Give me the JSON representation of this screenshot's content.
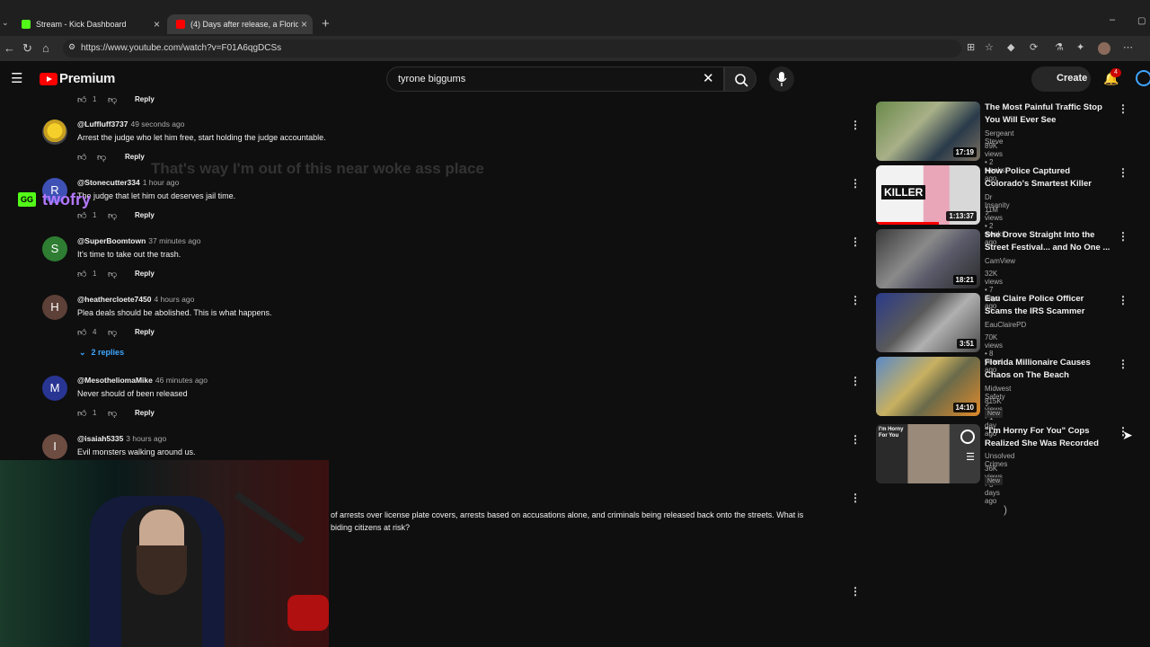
{
  "browser": {
    "tabs": [
      {
        "title": "Stream - Kick Dashboard",
        "favicon_color": "#53fc18"
      },
      {
        "title": "(4) Days after release, a Florida m",
        "favicon_color": "#ff0000"
      }
    ],
    "url": "https://www.youtube.com/watch?v=F01A6qgDCSs"
  },
  "header": {
    "logo": "Premium",
    "search_value": "tyrone biggums",
    "create_label": "Create",
    "notifications": "4"
  },
  "comments": [
    {
      "author": "",
      "time": "",
      "text": "",
      "likes": "1",
      "initial": ""
    },
    {
      "author": "@Luffluff3737",
      "time": "49 seconds ago",
      "text": "Arrest the judge who let him free, start holding the judge accountable.",
      "likes": "",
      "initial": ""
    },
    {
      "author": "@Stonecutter334",
      "time": "1 hour ago",
      "text": "The judge that let him out deserves jail time.",
      "likes": "1",
      "initial": "R"
    },
    {
      "author": "@SuperBoomtown",
      "time": "37 minutes ago",
      "text": "It's time to take out the trash.",
      "likes": "1",
      "initial": "S"
    },
    {
      "author": "@heathercloete7450",
      "time": "4 hours ago",
      "text": "Plea deals should be abolished. This is what happens.",
      "likes": "4",
      "initial": "H"
    },
    {
      "author": "@MesotheliomaMike",
      "time": "46 minutes ago",
      "text": "Never should of been released",
      "likes": "1",
      "initial": "M"
    },
    {
      "author": "@isaiah5335",
      "time": "3 hours ago",
      "text": "Evil monsters walking around us.",
      "likes": "",
      "initial": "I"
    }
  ],
  "labels": {
    "reply": "Reply",
    "replies": "2 replies"
  },
  "description_partial": {
    "line1": "of arrests over license plate covers, arrests based on accusations alone, and criminals being released back onto the streets. What is",
    "line2": "biding citizens at risk?"
  },
  "overlay": {
    "chat_text": "That's way I'm out of this near woke ass place",
    "username": "twofry",
    "badge": "GG"
  },
  "recommendations": [
    {
      "title": "The Most Painful Traffic Stop You Will Ever See",
      "channel": "Sergeant Steve",
      "meta": "89K views • 2 weeks ago",
      "duration": "17:19",
      "is_new": false
    },
    {
      "title": "How Police Captured Colorado's Smartest Killer",
      "channel": "Dr Insanity",
      "meta": "11M views • 2 weeks ago",
      "duration": "1:13:37",
      "is_new": false
    },
    {
      "title": "She Drove Straight Into the Street Festival... and No One ...",
      "channel": "CamView",
      "meta": "32K views • 7 days ago",
      "duration": "18:21",
      "is_new": false
    },
    {
      "title": "Eau Claire Police Officer Scams the IRS Scammer",
      "channel": "EauClairePD",
      "meta": "70K views • 8 years ago",
      "duration": "3:51",
      "is_new": false
    },
    {
      "title": "Florida Millionaire Causes Chaos on The Beach",
      "channel": "Midwest Safety",
      "meta": "815K views • 1 day ago",
      "duration": "14:10",
      "is_new": true
    },
    {
      "title": "\"I'm Horny For You\" Cops Realized She Was Recorded",
      "channel": "Unsolved Crimes",
      "meta": "36K views • 3 days ago",
      "duration": "",
      "is_new": true
    }
  ],
  "new_badge": "New",
  "thumb_text": {
    "killer": "KILLER",
    "horny": "I'm Horny For You"
  }
}
